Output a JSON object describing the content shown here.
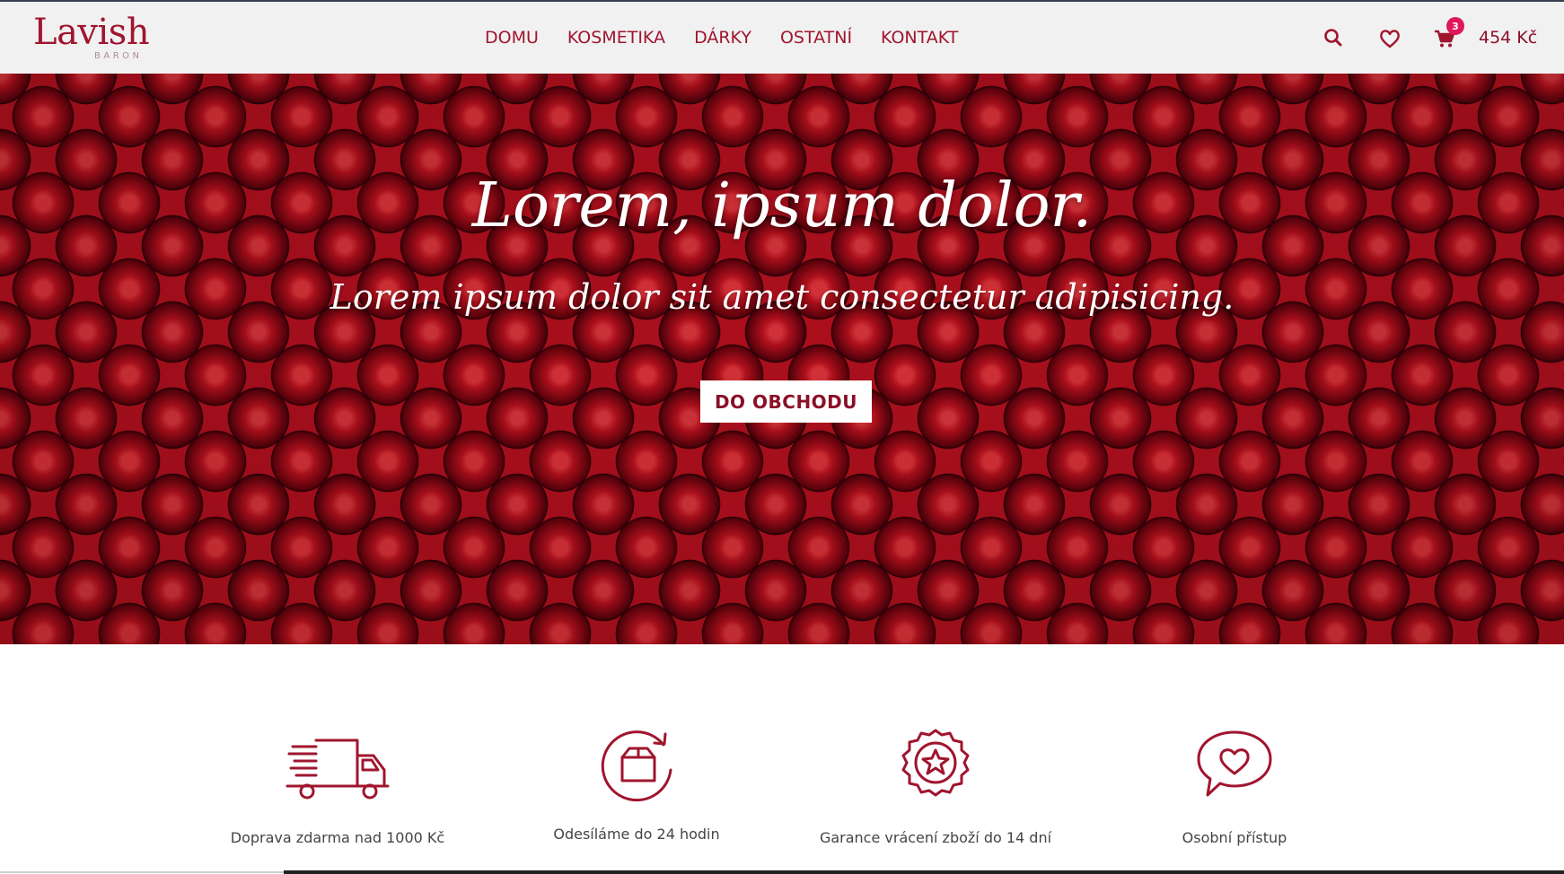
{
  "brand": {
    "name": "Lavish",
    "sub": "BARON"
  },
  "nav": {
    "items": [
      "DOMU",
      "KOSMETIKA",
      "DÁRKY",
      "OSTATNÍ",
      "KONTAKT"
    ]
  },
  "header_actions": {
    "search_icon": "search-icon",
    "wishlist_icon": "heart-icon",
    "cart_icon": "cart-icon",
    "cart_count": "3",
    "cart_total": "454 Kč"
  },
  "hero": {
    "title": "Lorem, ipsum dolor.",
    "subtitle": "Lorem ipsum dolor sit amet consectetur adipisicing.",
    "button_label": "DO OBCHODU"
  },
  "features": [
    {
      "icon": "delivery-truck-icon",
      "label": "Doprava zdarma nad 1000 Kč"
    },
    {
      "icon": "box-refresh-icon",
      "label": "Odesíláme do 24 hodin"
    },
    {
      "icon": "star-badge-icon",
      "label": "Garance vrácení zboží do 14 dní"
    },
    {
      "icon": "heart-chat-icon",
      "label": "Osobní přístup"
    }
  ],
  "colors": {
    "accent": "#a0152e",
    "header_bg": "#f1f1f1",
    "badge": "#e0185a"
  }
}
